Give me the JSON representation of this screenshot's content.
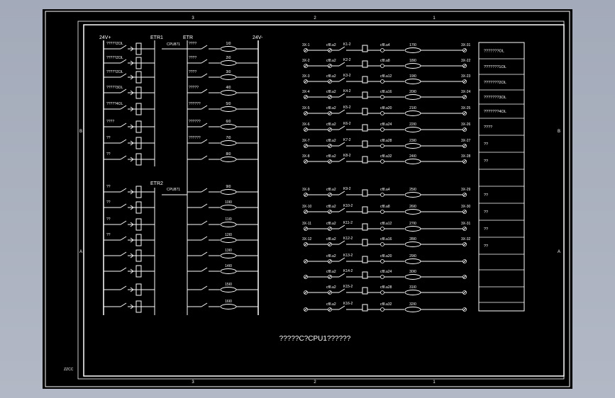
{
  "drawing": {
    "title": "?????C?CPU1??????",
    "stamp": "ZZCC",
    "zones_top": [
      "3",
      "2",
      "1"
    ],
    "zones_bottom": [
      "3",
      "2",
      "1"
    ],
    "zones_side": [
      "B",
      "A"
    ],
    "rail_positive": "24V+",
    "rail_negative": "24V-",
    "block_labels": [
      "ETR1",
      "ETR",
      "ETR2"
    ],
    "module_labels": [
      "CPU871",
      "CPU871"
    ],
    "left_rows": [
      {
        "input": "?????ZOL",
        "coil": "1I0",
        "contact": "????"
      },
      {
        "input": "?????ZOL",
        "coil": "2I0",
        "contact": "????"
      },
      {
        "input": "?????ZOL",
        "coil": "3I0",
        "contact": "????"
      },
      {
        "input": "?????3OL",
        "coil": "4I0",
        "contact": "?????"
      },
      {
        "input": "?????4OL",
        "coil": "5I0",
        "contact": "??????"
      },
      {
        "input": "????",
        "coil": "6I0",
        "contact": "??????"
      },
      {
        "input": "??",
        "coil": "7I0",
        "contact": "??????"
      },
      {
        "input": "??",
        "coil": "8I0",
        "contact": ""
      },
      {
        "input": "??",
        "coil": "9I0",
        "contact": ""
      },
      {
        "input": "??",
        "coil": "10I0",
        "contact": ""
      },
      {
        "input": "??",
        "coil": "11I0",
        "contact": ""
      },
      {
        "input": "??",
        "coil": "12I0",
        "contact": ""
      },
      {
        "input": "",
        "coil": "13I0",
        "contact": ""
      },
      {
        "input": "",
        "coil": "14I0",
        "contact": ""
      },
      {
        "input": "",
        "coil": "15I0",
        "contact": ""
      },
      {
        "input": "",
        "coil": "16I0",
        "contact": ""
      }
    ],
    "right_rows": [
      {
        "left_term": "3X-1",
        "wire": "cf8.a2",
        "relay": "K1-2",
        "out_wire": "cf8.a4",
        "coil": "17I0",
        "right_term": "3X-31"
      },
      {
        "left_term": "3X-2",
        "wire": "cf8.a2",
        "relay": "K2-2",
        "out_wire": "cf8.a8",
        "coil": "18I0",
        "right_term": "3X-22"
      },
      {
        "left_term": "3X-3",
        "wire": "cf8.a2",
        "relay": "K3-2",
        "out_wire": "cf8.a12",
        "coil": "19I0",
        "right_term": "3X-23"
      },
      {
        "left_term": "3X-4",
        "wire": "cf8.a2",
        "relay": "K4-2",
        "out_wire": "cf8.a16",
        "coil": "20I0",
        "right_term": "3X-24"
      },
      {
        "left_term": "3X-5",
        "wire": "cf8.a2",
        "relay": "K5-2",
        "out_wire": "cf8.a20",
        "coil": "21I0",
        "right_term": "3X-25"
      },
      {
        "left_term": "3X-6",
        "wire": "cf8.a2",
        "relay": "K6-2",
        "out_wire": "cf8.a24",
        "coil": "22I0",
        "right_term": "3X-26"
      },
      {
        "left_term": "3X-7",
        "wire": "cf8.a2",
        "relay": "K7-2",
        "out_wire": "cf8.a28",
        "coil": "23I0",
        "right_term": "3X-27"
      },
      {
        "left_term": "3X-8",
        "wire": "cf8.a2",
        "relay": "K8-2",
        "out_wire": "cf8.a32",
        "coil": "24I0",
        "right_term": "3X-28"
      },
      {
        "left_term": "3X-9",
        "wire": "cf8.a2",
        "relay": "K9-2",
        "out_wire": "cf8.a4",
        "coil": "25I0",
        "right_term": "3X-29"
      },
      {
        "left_term": "3X-10",
        "wire": "cf8.a2",
        "relay": "K10-2",
        "out_wire": "cf8.a8",
        "coil": "26I0",
        "right_term": "3X-30"
      },
      {
        "left_term": "3X-11",
        "wire": "cf8.a2",
        "relay": "K11-2",
        "out_wire": "cf8.a12",
        "coil": "27I0",
        "right_term": "3X-31"
      },
      {
        "left_term": "3X-12",
        "wire": "cf8.a2",
        "relay": "K12-2",
        "out_wire": "cf8.a16",
        "coil": "28I0",
        "right_term": "3X-32"
      },
      {
        "left_term": "",
        "wire": "cf8.a2",
        "relay": "K13-2",
        "out_wire": "cf8.a20",
        "coil": "29I0",
        "right_term": ""
      },
      {
        "left_term": "",
        "wire": "cf8.a2",
        "relay": "K14-2",
        "out_wire": "cf8.a24",
        "coil": "30I0",
        "right_term": ""
      },
      {
        "left_term": "",
        "wire": "cf8.a2",
        "relay": "K15-2",
        "out_wire": "cf8.a28",
        "coil": "31I0",
        "right_term": ""
      },
      {
        "left_term": "",
        "wire": "cf8.a2",
        "relay": "K16-2",
        "out_wire": "cf8.a32",
        "coil": "32I0",
        "right_term": ""
      }
    ],
    "legend": [
      "???????OL",
      "???????1OL",
      "???????2OL",
      "???????3OL",
      "???????4OL",
      "????",
      "??",
      "??",
      "",
      "??",
      "??",
      "??",
      "??",
      "",
      "",
      "",
      ""
    ]
  }
}
